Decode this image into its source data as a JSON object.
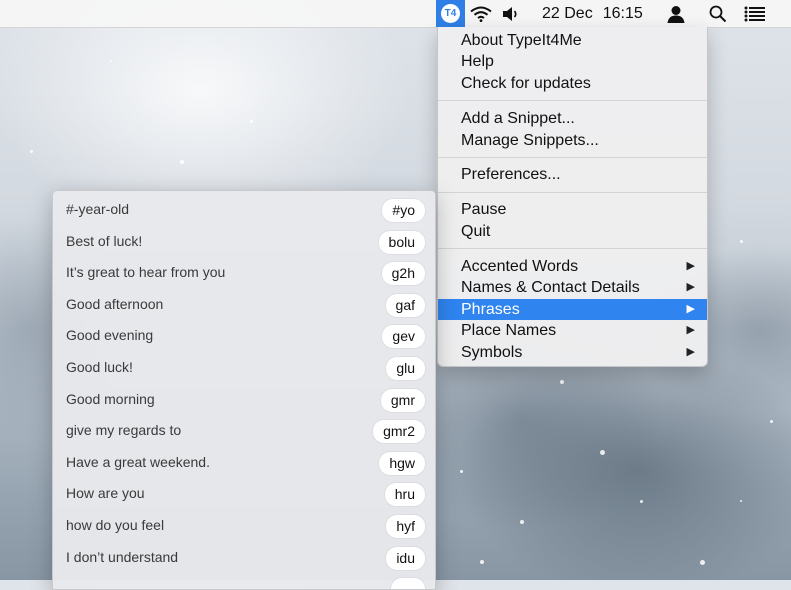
{
  "menubar": {
    "app_icon": "typeit4me-icon",
    "date": "22 Dec",
    "time": "16:15",
    "icons": [
      "wifi-icon",
      "volume-icon",
      "user-icon",
      "search-icon",
      "notification-list-icon"
    ]
  },
  "menu": {
    "groups": [
      [
        "About TypeIt4Me",
        "Help",
        "Check for updates"
      ],
      [
        "Add a Snippet...",
        "Manage Snippets..."
      ],
      [
        "Preferences..."
      ],
      [
        "Pause",
        "Quit"
      ]
    ],
    "submenus": [
      {
        "label": "Accented Words"
      },
      {
        "label": "Names & Contact Details"
      },
      {
        "label": "Phrases",
        "highlighted": true
      },
      {
        "label": "Place Names"
      },
      {
        "label": "Symbols"
      }
    ],
    "submenu_arrow": "▶"
  },
  "snippets": [
    {
      "phrase": "#-year-old",
      "abbr": "#yo"
    },
    {
      "phrase": "Best of luck!",
      "abbr": "bolu"
    },
    {
      "phrase": "It’s great to hear from you",
      "abbr": "g2h"
    },
    {
      "phrase": "Good afternoon",
      "abbr": "gaf"
    },
    {
      "phrase": "Good evening",
      "abbr": "gev"
    },
    {
      "phrase": "Good luck!",
      "abbr": "glu"
    },
    {
      "phrase": "Good morning",
      "abbr": "gmr"
    },
    {
      "phrase": "give my regards to",
      "abbr": "gmr2"
    },
    {
      "phrase": "Have a great weekend.",
      "abbr": "hgw"
    },
    {
      "phrase": "How are you",
      "abbr": "hru"
    },
    {
      "phrase": "how do you feel",
      "abbr": "hyf"
    },
    {
      "phrase": "I don’t understand",
      "abbr": "idu"
    }
  ],
  "colors": {
    "highlight": "#2f84ef",
    "app_icon_bg": "#2f7fe6"
  }
}
